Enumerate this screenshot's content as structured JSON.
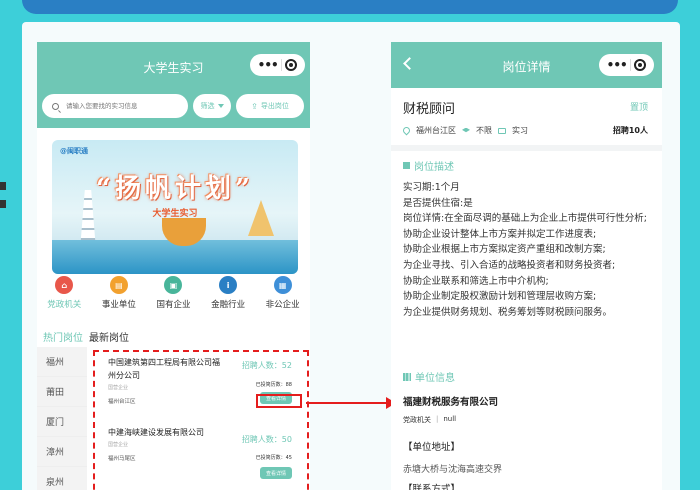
{
  "theme": {
    "accent": "#6fc7b5",
    "highlight_red": "#e41d1d",
    "background": "#3dcfd9",
    "banner": "#2a7fc4"
  },
  "left_screen": {
    "title": "大学生实习",
    "search": {
      "placeholder": "请输入您要找的实习信息"
    },
    "filter_label": "筛选",
    "export_label": "导出岗位",
    "banner": {
      "logo_text": "@闽职通",
      "title": "“扬帆计划”",
      "subtitle": "大学生实习"
    },
    "categories": [
      {
        "label": "党政机关",
        "icon": "government-icon",
        "color": "#e8574a"
      },
      {
        "label": "事业单位",
        "icon": "institution-icon",
        "color": "#f2a12e"
      },
      {
        "label": "国有企业",
        "icon": "state-enterprise-icon",
        "color": "#48b59a"
      },
      {
        "label": "金融行业",
        "icon": "finance-icon",
        "color": "#2a7fc4"
      },
      {
        "label": "非公企业",
        "icon": "private-enterprise-icon",
        "color": "#3e8fd8"
      }
    ],
    "tabs": [
      "热门岗位",
      "最新岗位"
    ],
    "cities": [
      "福州",
      "莆田",
      "厦门",
      "漳州",
      "泉州"
    ],
    "jobs": [
      {
        "name": "中国建筑第四工程局有限公司福州分公司",
        "type": "国营企业",
        "location": "福州台江区",
        "recruit": "招聘人数：52",
        "posted": "已投简历数：88",
        "view": "查看详情"
      },
      {
        "name": "中建海峡建设发展有限公司",
        "type": "国营企业",
        "location": "福州马尾区",
        "recruit": "招聘人数：50",
        "posted": "已投简历数：45",
        "view": "查看详情"
      }
    ]
  },
  "right_screen": {
    "title": "岗位详情",
    "job_title": "财税顾问",
    "follow": "置顶",
    "location": "福州台江区",
    "education": "不限",
    "job_type": "实习",
    "recruit": "招聘10人",
    "section_desc": "岗位描述",
    "description": [
      "实习期:1个月",
      "是否提供住宿:是",
      "岗位详情:在全面尽调的基础上为企业上市提供可行性分析;",
      "协助企业设计整体上市方案并拟定工作进度表;",
      "协助企业根据上市方案拟定资产重组和改制方案;",
      "为企业寻找、引入合适的战略投资者和财务投资者;",
      "协助企业联系和筛选上市中介机构;",
      "协助企业制定股权激励计划和管理层收购方案;",
      "为企业提供财务规划、税务筹划等财税顾问服务。"
    ],
    "section_company": "单位信息",
    "company": "福建财税服务有限公司",
    "company_category": "党政机关",
    "company_extra": "null",
    "address_heading": "【单位地址】",
    "address": "赤塘大桥与沈海高速交界",
    "contact_heading": "【联系方式】"
  }
}
